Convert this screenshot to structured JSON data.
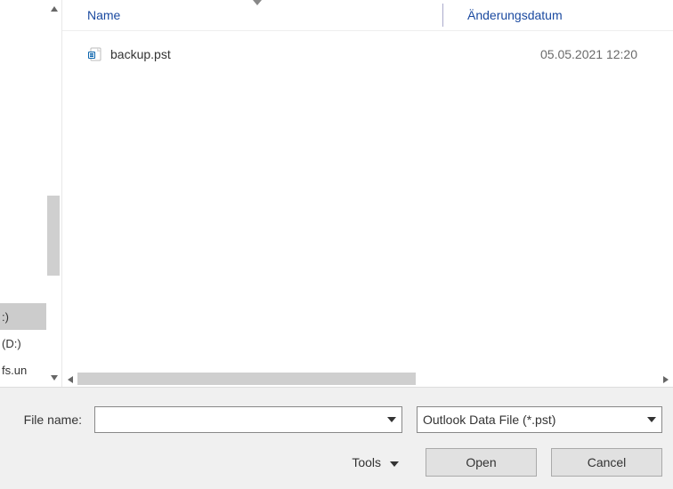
{
  "left": {
    "items": [
      {
        "label": ":)",
        "sel": true
      },
      {
        "label": "(D:)",
        "sel": false
      },
      {
        "label": "fs.un",
        "sel": false
      }
    ]
  },
  "columns": {
    "name": "Name",
    "date": "Änderungsdatum"
  },
  "files": [
    {
      "name": "backup.pst",
      "date": "05.05.2021 12:20",
      "icon": "outlook-pst"
    }
  ],
  "form": {
    "fileNameLabel": "File name:",
    "fileNameValue": "",
    "fileTypeLabel": "Outlook Data File (*.pst)"
  },
  "buttons": {
    "tools": "Tools",
    "open": "Open",
    "cancel": "Cancel"
  }
}
